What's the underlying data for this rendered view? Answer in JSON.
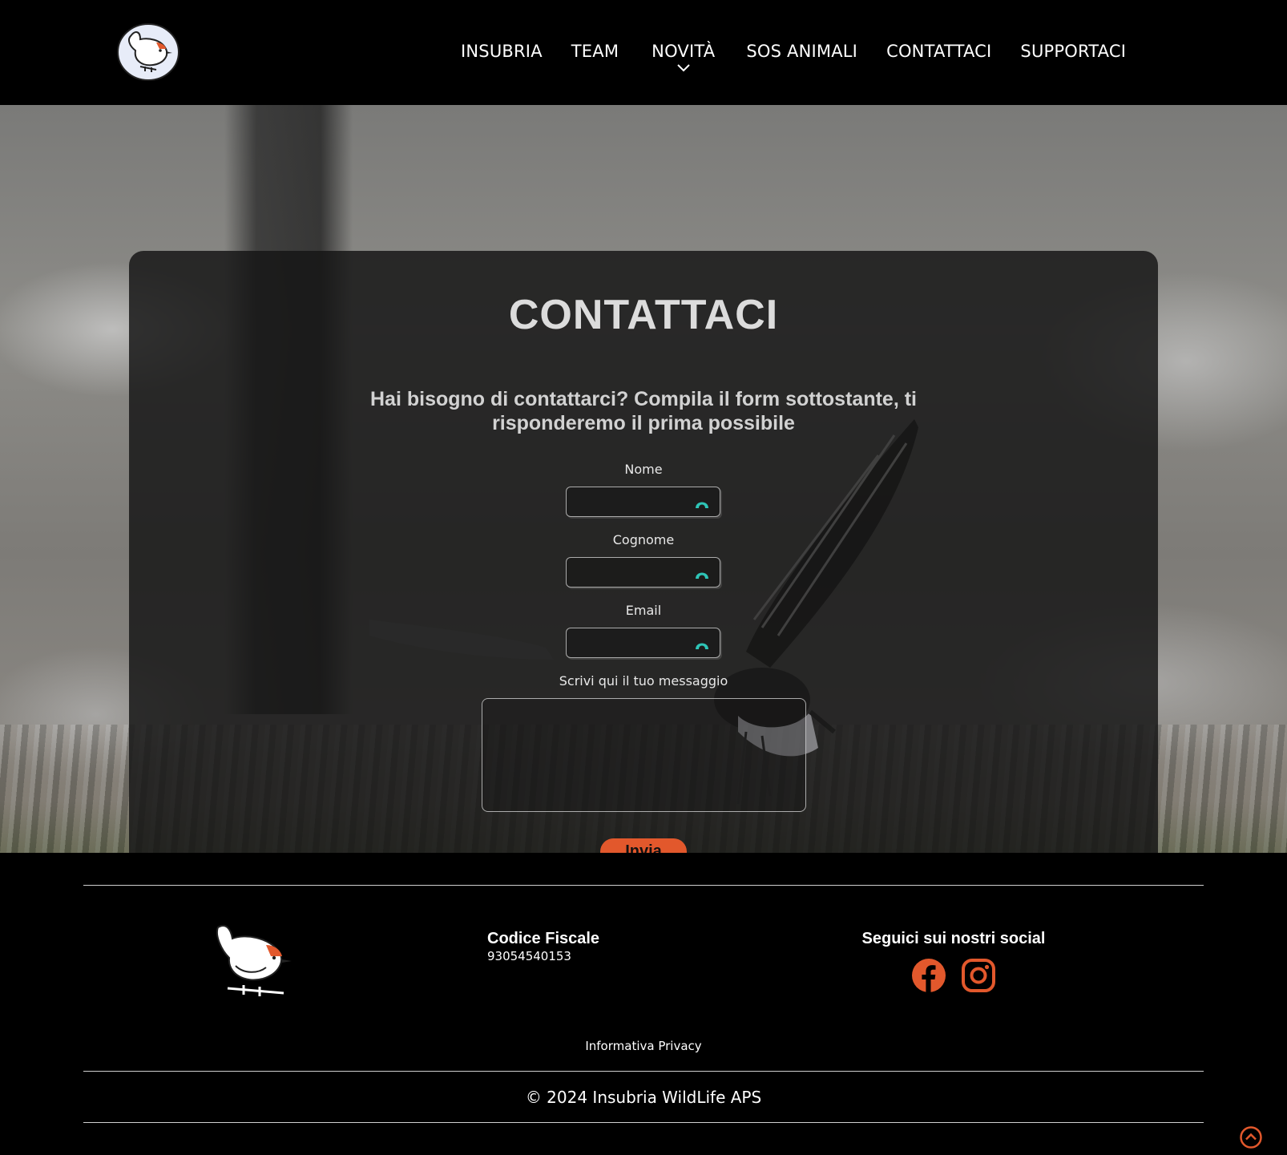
{
  "nav": {
    "items": [
      {
        "label": "INSUBRIA"
      },
      {
        "label": "TEAM"
      },
      {
        "label": "NOVITÀ"
      },
      {
        "label": "SOS ANIMALI"
      },
      {
        "label": "CONTATTACI"
      },
      {
        "label": "SUPPORTACI"
      }
    ]
  },
  "contact": {
    "title": "CONTATTACI",
    "subtitle": "Hai bisogno di contattarci? Compila il form sottostante, ti risponderemo il prima possibile",
    "fields": {
      "name_label": "Nome",
      "surname_label": "Cognome",
      "email_label": "Email",
      "message_label": "Scrivi qui il tuo messaggio"
    },
    "send_label": "Invia"
  },
  "footer": {
    "cf_title": "Codice Fiscale",
    "cf_value": "93054540153",
    "social_title": "Seguici sui nostri social",
    "privacy": "Informativa Privacy",
    "copyright": "© 2024 Insubria WildLife APS"
  },
  "colors": {
    "accent": "#e2582c",
    "icon_teal": "#2ec4b6"
  },
  "icons": [
    "logo-bird-icon",
    "chevron-down-icon",
    "password-manager-icon",
    "facebook-icon",
    "instagram-icon",
    "scroll-top-icon"
  ]
}
